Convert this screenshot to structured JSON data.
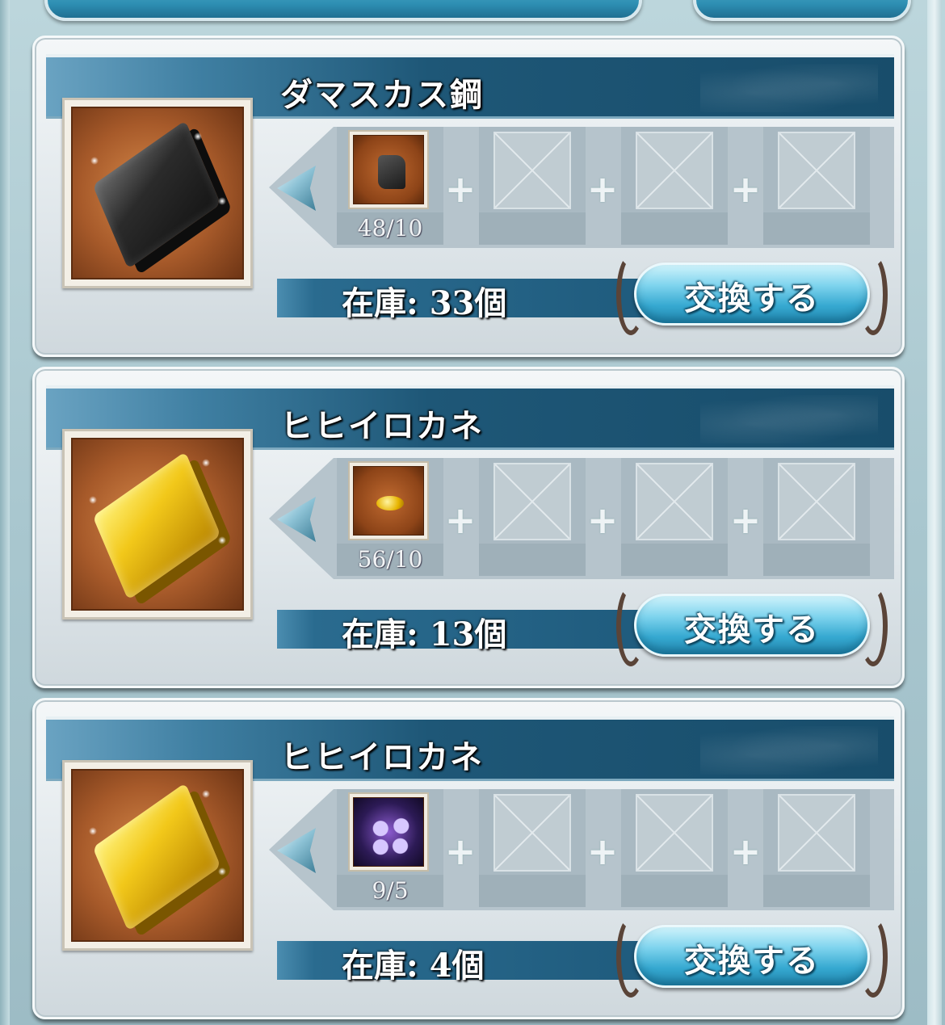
{
  "exchange_items": [
    {
      "name": "ダマスカス鋼",
      "ingot": "iron-ingot-icon",
      "material": "rock-material-icon",
      "material_count": "48/10",
      "stock": "在庫: 33個",
      "button_label": "交換する"
    },
    {
      "name": "ヒヒイロカネ",
      "ingot": "gold-ingot-icon",
      "material": "gold-nugget-material-icon",
      "material_count": "56/10",
      "stock": "在庫: 13個",
      "button_label": "交換する"
    },
    {
      "name": "ヒヒイロカネ",
      "ingot": "gold-ingot-icon",
      "material": "purple-orbs-material-icon",
      "material_count": "9/5",
      "stock": "在庫: 4個",
      "button_label": "交換する"
    }
  ],
  "colors": {
    "header_dark": "#184d6b",
    "button_cyan": "#36a9d1",
    "item_frame": "#a75a2a"
  }
}
